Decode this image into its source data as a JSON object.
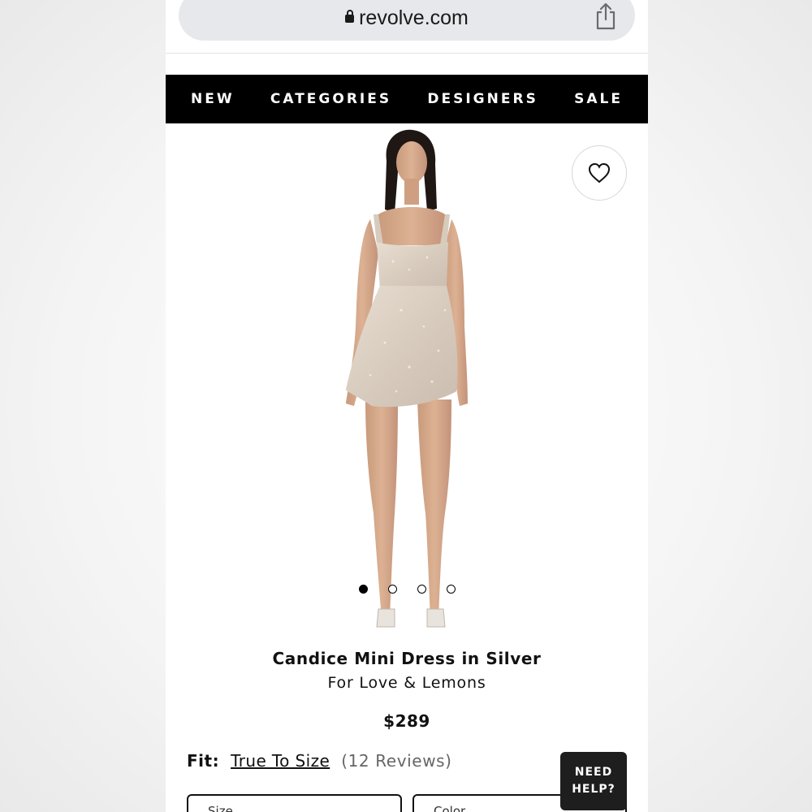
{
  "browser": {
    "url": "revolve.com"
  },
  "nav": {
    "items": [
      "NEW",
      "CATEGORIES",
      "DESIGNERS",
      "SALE"
    ]
  },
  "gallery": {
    "image_count": 4,
    "active_index": 0
  },
  "product": {
    "name": "Candice Mini Dress in Silver",
    "brand": "For Love & Lemons",
    "price": "$289"
  },
  "fit": {
    "label": "Fit:",
    "value": "True To Size",
    "reviews": "(12 Reviews)"
  },
  "selectors": {
    "size_label": "Size",
    "color_label": "Color"
  },
  "help": {
    "line1": "NEED",
    "line2": "HELP?"
  },
  "icons": [
    "lock-icon",
    "share-icon",
    "heart-icon"
  ]
}
